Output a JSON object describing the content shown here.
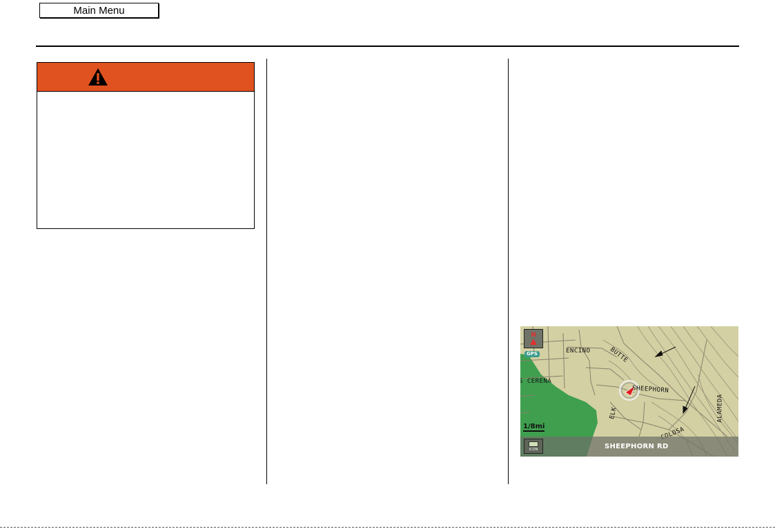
{
  "header": {
    "main_menu_label": "Main Menu"
  },
  "warning": {
    "icon": "warning-triangle-icon",
    "header_color": "#e0521f"
  },
  "map": {
    "street_labels": {
      "encino": "ENCINO",
      "butte": "BUTTE",
      "cerena": "S CERENA",
      "sheephorn": "SHEEPHORN",
      "elk": "ELK",
      "alameda": "ALAMEDA",
      "colosa": "COLOSA"
    },
    "north_indicator": "N",
    "gps_badge": "GPS",
    "scale": "1/8mi",
    "icon_button_label": "ICON",
    "current_street": "SHEEPHORN RD",
    "colors": {
      "land": "#d3d0a3",
      "park": "#3f9f4f",
      "roads": "#8a7f6a",
      "vehicle": "#e02020"
    }
  }
}
